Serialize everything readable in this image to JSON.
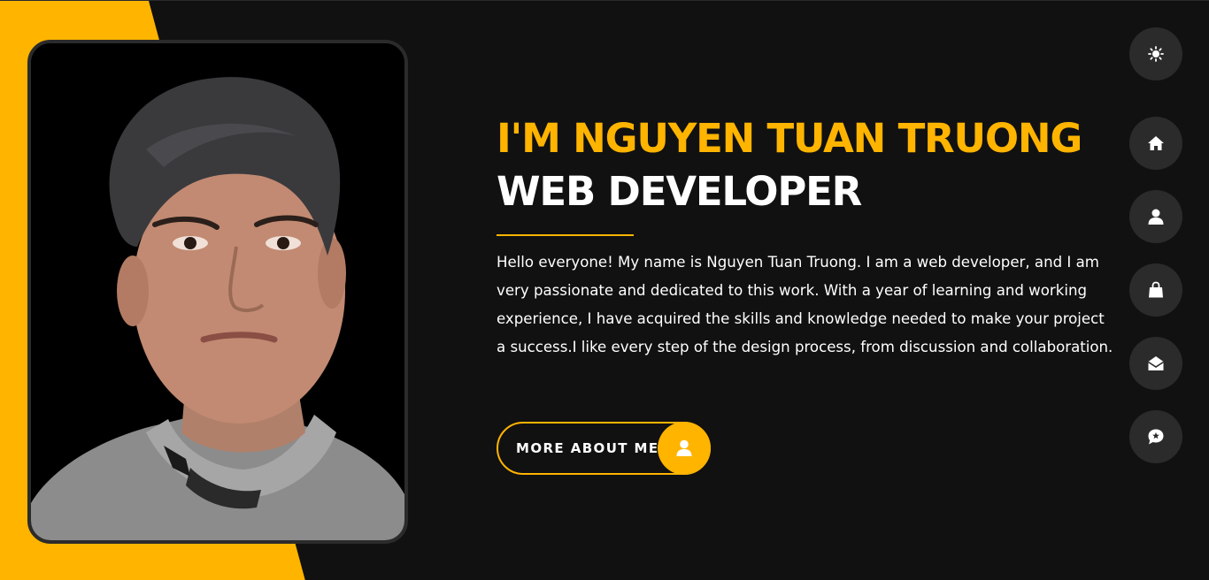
{
  "hero": {
    "title_line1": "I'M NGUYEN TUAN TRUONG",
    "title_line2": "WEB DEVELOPER",
    "intro": "Hello everyone! My name is Nguyen Tuan Truong. I am a web developer, and I am very passionate and dedicated to this work. With a year of learning and working experience, I have acquired the skills and knowledge needed to make your project a success.I like every step of the design process, from discussion and collaboration.",
    "cta_label": "MORE ABOUT ME",
    "cta_icon": "user-icon"
  },
  "photo": {
    "subject": "profile-photo"
  },
  "side_nav": {
    "items": [
      {
        "icon": "sun-icon"
      },
      {
        "icon": "home-icon"
      },
      {
        "icon": "user-icon"
      },
      {
        "icon": "briefcase-icon"
      },
      {
        "icon": "envelope-open-icon"
      },
      {
        "icon": "comment-icon"
      }
    ]
  },
  "colors": {
    "accent": "#ffb400",
    "background": "#111111",
    "nav_button": "#2b2b2b",
    "text": "#ffffff"
  }
}
